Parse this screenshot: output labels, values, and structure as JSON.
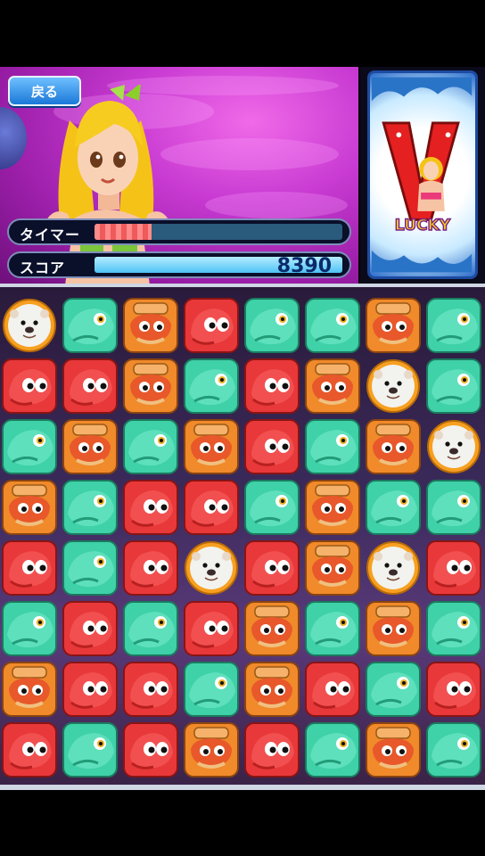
{
  "header": {
    "back_label": "戻る",
    "timer_label": "タイマー",
    "timer_fraction": 0.23,
    "score_label": "スコア",
    "score_value": "8390"
  },
  "lucky_panel": {
    "logo_text": "LUCKY",
    "letter": "V"
  },
  "colors": {
    "red": "#e8383a",
    "green": "#3fd1a8",
    "orange": "#f08a2a",
    "otter": "#f2f2ee"
  },
  "board": {
    "rows": 8,
    "cols": 8,
    "tiles": [
      [
        "otter",
        "green",
        "orange",
        "red",
        "green",
        "green",
        "orange",
        "green"
      ],
      [
        "red",
        "red",
        "orange",
        "green",
        "red",
        "orange",
        "otter",
        "green"
      ],
      [
        "green",
        "orange",
        "green",
        "orange",
        "red",
        "green",
        "orange",
        "otter"
      ],
      [
        "orange",
        "green",
        "red",
        "red",
        "green",
        "orange",
        "green",
        "green"
      ],
      [
        "red",
        "green",
        "red",
        "otter",
        "red",
        "orange",
        "otter",
        "red"
      ],
      [
        "green",
        "red",
        "green",
        "red",
        "orange",
        "green",
        "orange",
        "green"
      ],
      [
        "orange",
        "red",
        "red",
        "green",
        "orange",
        "red",
        "green",
        "red"
      ],
      [
        "red",
        "green",
        "red",
        "orange",
        "red",
        "green",
        "orange",
        "green"
      ]
    ],
    "tile_kinds": {
      "red": "red-octopus-icon",
      "green": "green-fish-icon",
      "orange": "orange-crab-icon",
      "otter": "sea-otter-icon"
    }
  }
}
